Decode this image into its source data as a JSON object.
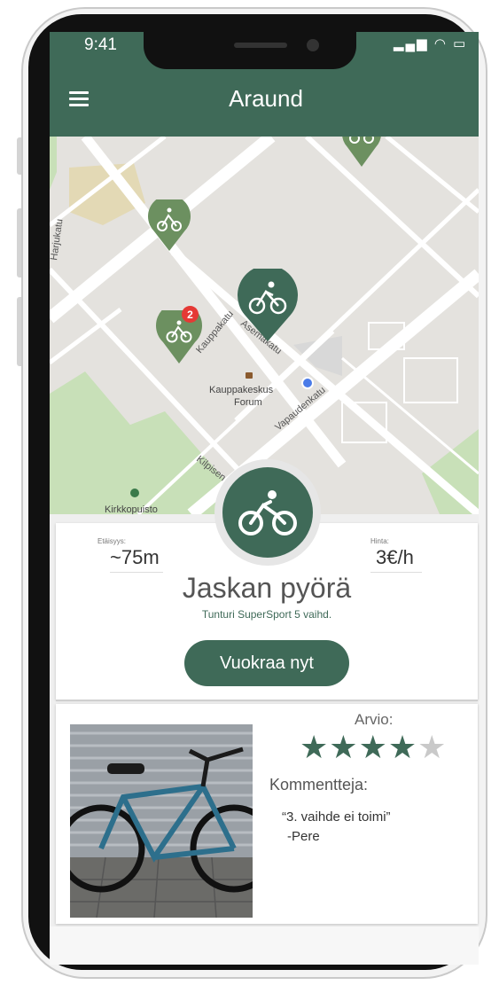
{
  "status_bar": {
    "time": "9:41",
    "icons": "▂▄▆ ◠ ▭"
  },
  "header": {
    "title": "Araund"
  },
  "map": {
    "streets": [
      "Kauppakatu",
      "Asemakatu",
      "Vapaudenkatu",
      "Kilpisen",
      "Harjukatu"
    ],
    "poi_name": "Kauppakeskus Forum",
    "park_name": "Kirkkopuisto",
    "cluster_badge": "2"
  },
  "bike": {
    "distance_label": "Etäisyys:",
    "distance_value": "~75m",
    "price_label": "Hinta:",
    "price_value": "3€/h",
    "name": "Jaskan pyörä",
    "model": "Tunturi SuperSport 5 vaihd.",
    "rent_button": "Vuokraa nyt"
  },
  "reviews": {
    "rating_label": "Arvio:",
    "rating": 4,
    "rating_max": 5,
    "comments_label": "Kommentteja:",
    "comment_text": "“3. vaihde ei toimi”",
    "comment_author": "-Pere"
  },
  "colors": {
    "brand": "#3f6a58",
    "badge": "#e53935",
    "location_dot": "#4a7be8"
  }
}
